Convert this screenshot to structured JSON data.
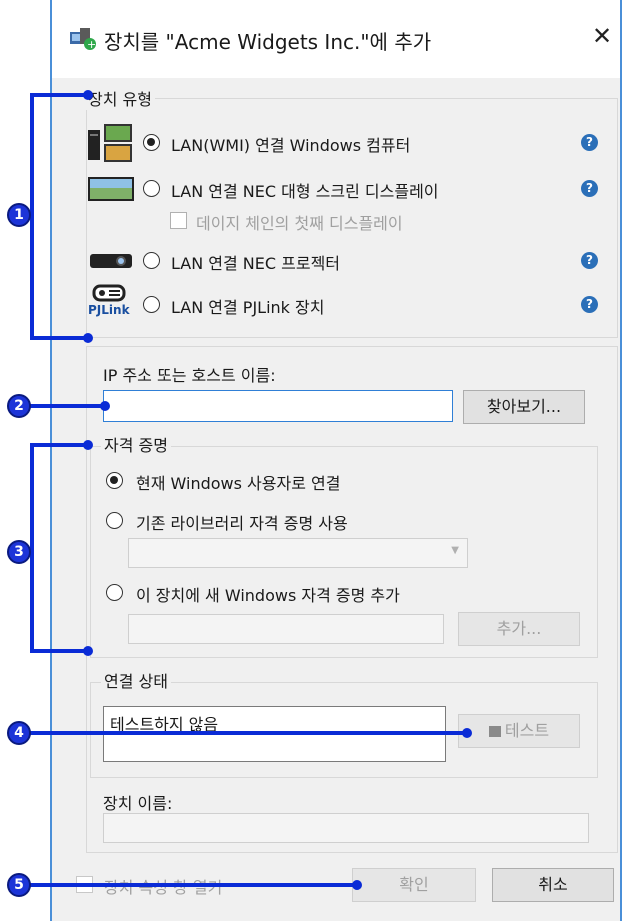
{
  "window": {
    "title": "장치를 \"Acme Widgets Inc.\"에 추가",
    "close_glyph": "✕"
  },
  "device_type": {
    "group_label": "장치 유형",
    "options": [
      {
        "label": "LAN(WMI) 연결 Windows 컴퓨터",
        "selected": true
      },
      {
        "label": "LAN 연결 NEC 대형 스크린 디스플레이",
        "selected": false
      },
      {
        "label": "LAN 연결 NEC 프로젝터",
        "selected": false
      },
      {
        "label": "LAN 연결 PJLink 장치",
        "selected": false
      }
    ],
    "daisy_chain_label": "데이지 체인의 첫째 디스플레이",
    "pjlink_logo_text": "PJLink",
    "help_glyph": "?"
  },
  "address": {
    "label": "IP 주소 또는 호스트 이름:",
    "value": "",
    "browse_button": "찾아보기..."
  },
  "credentials": {
    "group_label": "자격 증명",
    "options": [
      {
        "label": "현재 Windows 사용자로 연결",
        "selected": true
      },
      {
        "label": "기존 라이브러리 자격 증명 사용",
        "selected": false
      },
      {
        "label": "이 장치에 새 Windows 자격 증명 추가",
        "selected": false
      }
    ],
    "add_button": "추가..."
  },
  "connection_status": {
    "group_label": "연결 상태",
    "status_text": "테스트하지 않음",
    "test_button": "테스트"
  },
  "device_name": {
    "label": "장치 이름:",
    "value": ""
  },
  "footer": {
    "open_properties_label": "장치 속성 창 열기",
    "ok_button": "확인",
    "cancel_button": "취소"
  },
  "callouts": [
    "1",
    "2",
    "3",
    "4",
    "5"
  ],
  "colors": {
    "callout": "#0a2bd6",
    "window_border": "#4a8fd8",
    "help_icon": "#2b6fb8"
  }
}
